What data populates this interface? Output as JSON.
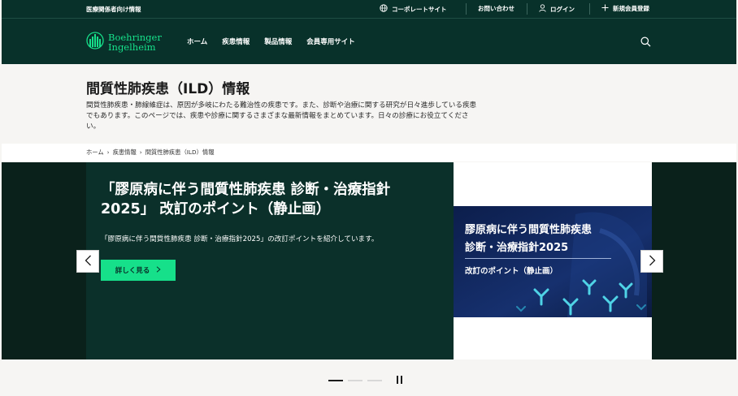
{
  "topbar": {
    "audience": "医療関係者向け情報",
    "corporate_site": "コーポレートサイト",
    "contact": "お問い合わせ",
    "login": "ログイン",
    "register": "新規会員登録"
  },
  "nav": {
    "logo_line1": "Boehringer",
    "logo_line2": "Ingelheim",
    "items": [
      {
        "label": "ホーム"
      },
      {
        "label": "疾患情報"
      },
      {
        "label": "製品情報"
      },
      {
        "label": "会員専用サイト"
      }
    ]
  },
  "page": {
    "title": "間質性肺疾患（ILD）情報",
    "intro": "間質性肺疾患・肺線維症は、原因が多岐にわたる難治性の疾患です。また、診断や治療に関する研究が日々進歩している疾患でもあります。このページでは、疾患や診療に関するさまざまな最新情報をまとめています。日々の診療にお役立てください。"
  },
  "breadcrumb": {
    "items": [
      {
        "label": "ホーム"
      },
      {
        "label": "疾患情報"
      },
      {
        "label": "間質性肺疾患（ILD）情報"
      }
    ]
  },
  "hero": {
    "title": "「膠原病に伴う間質性肺疾患 診断・治療指針2025」 改訂のポイント（静止画）",
    "description": "「膠原病に伴う間質性肺疾患 診断・治療指針2025」の改訂ポイントを紹介しています。",
    "button_label": "詳しく見る",
    "card": {
      "line1": "膠原病に伴う間質性肺疾患",
      "line2": "診断・治療指針2025",
      "line3": "改訂のポイント（静止画）"
    }
  },
  "colors": {
    "brand_dark": "#08312a",
    "accent_green": "#16e08a",
    "card_navy": "#0c1e4c"
  }
}
